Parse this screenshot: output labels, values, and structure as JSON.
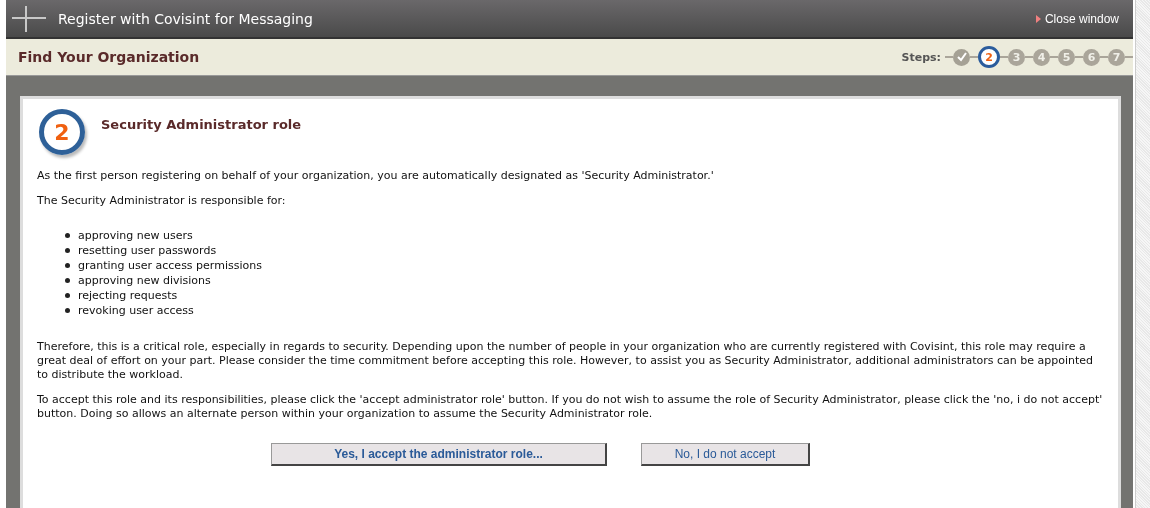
{
  "window": {
    "title": "Register with Covisint for Messaging",
    "close_link": "Close window"
  },
  "header": {
    "title": "Find Your Organization",
    "steps_label": "Steps:",
    "steps": [
      {
        "done": true,
        "selected": false
      },
      {
        "label": "2",
        "done": false,
        "selected": true
      },
      {
        "label": "3",
        "done": false,
        "selected": false
      },
      {
        "label": "4",
        "done": false,
        "selected": false
      },
      {
        "label": "5",
        "done": false,
        "selected": false
      },
      {
        "label": "6",
        "done": false,
        "selected": false
      },
      {
        "label": "7",
        "done": false,
        "selected": false
      }
    ]
  },
  "content": {
    "step_number": "2",
    "title": "Security Administrator role",
    "intro": "As the first person registering on behalf of your organization, you are automatically designated as 'Security Administrator.'",
    "list_heading": "The Security Administrator is responsible for:",
    "responsibilities": [
      "approving new users",
      "resetting user passwords",
      "granting user access permissions",
      "approving new divisions",
      "rejecting requests",
      "revoking user access"
    ],
    "paragraphs": [
      "Therefore, this is a critical role, especially in regards to security. Depending upon the number of people in your organization who are currently registered with Covisint, this role may require a great deal of effort on your part. Please consider the time commitment before accepting this role. However, to assist you as Security Administrator, additional administrators can be appointed to distribute the workload.",
      "To accept this role and its responsibilities, please click the 'accept administrator role' button. If you do not wish to assume the role of Security Administrator, please click the 'no, i do not accept' button. Doing so allows an alternate person within your organization to assume the Security Administrator role."
    ],
    "buttons": [
      {
        "label": "Yes, I accept the administrator role...",
        "kind": "primary"
      },
      {
        "label": "No, I do not accept",
        "kind": "secondary"
      }
    ]
  }
}
